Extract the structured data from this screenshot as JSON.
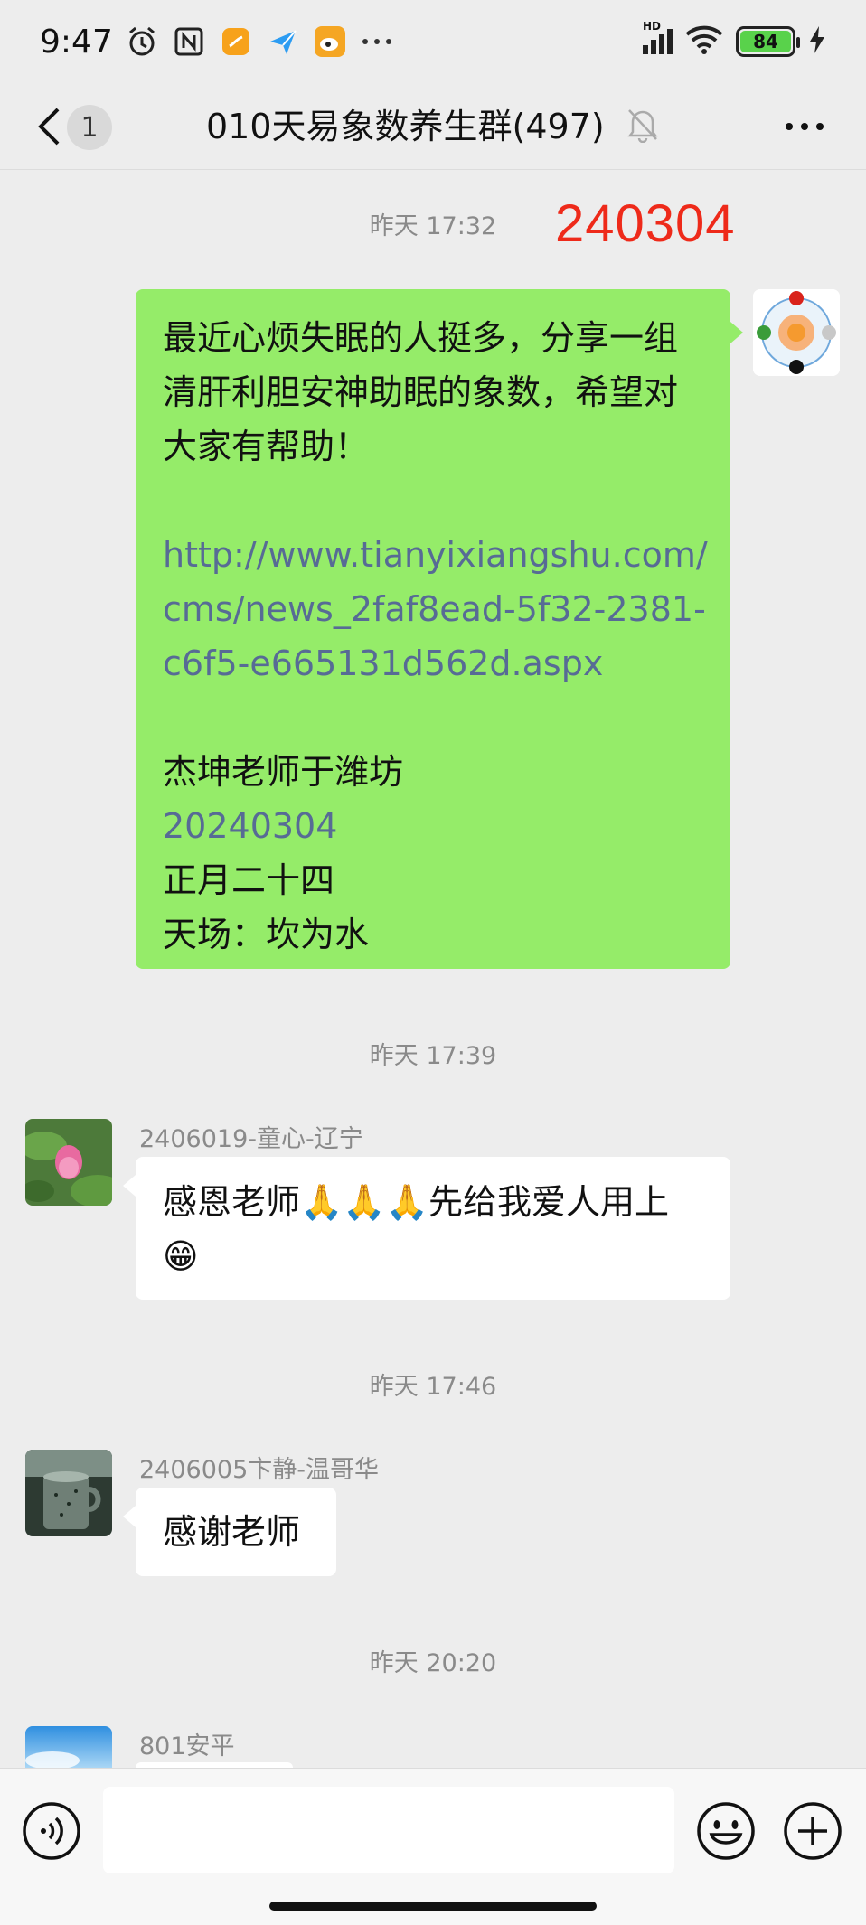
{
  "status_bar": {
    "time": "9:47",
    "network": "HD",
    "battery": "84"
  },
  "header": {
    "unread_count": "1",
    "title": "010天易象数养生群(497)"
  },
  "stamp": "240304",
  "messages": [
    {
      "time": "昨天 17:32",
      "type": "outgoing",
      "lines": [
        {
          "text": "最近心烦失眠的人挺多，分享一组",
          "link": false
        },
        {
          "text": "清肝利胆安神助眠的象数，希望对",
          "link": false
        },
        {
          "text": "大家有帮助！",
          "link": false
        },
        {
          "text": "",
          "link": false
        },
        {
          "text": "http://www.tianyixiangshu.com/",
          "link": true
        },
        {
          "text": "cms/news_2faf8ead-5f32-2381-",
          "link": true
        },
        {
          "text": "c6f5-e665131d562d.aspx",
          "link": true
        },
        {
          "text": "",
          "link": false
        },
        {
          "text": "杰坤老师于潍坊",
          "link": false
        },
        {
          "text": "20240304",
          "link": true
        },
        {
          "text": "正月二十四",
          "link": false
        },
        {
          "text": "天场：坎为水",
          "link": false
        }
      ]
    },
    {
      "time": "昨天 17:39",
      "type": "incoming",
      "sender": "2406019-童心-辽宁",
      "lines": [
        {
          "text": "感恩老师🙏🙏🙏先给我爱人用上",
          "link": false
        },
        {
          "text": "😁",
          "link": false
        }
      ]
    },
    {
      "time": "昨天 17:46",
      "type": "incoming",
      "sender": "2406005卞静-温哥华",
      "lines": [
        {
          "text": "感谢老师",
          "link": false
        }
      ]
    },
    {
      "time": "昨天 20:20",
      "type": "incoming",
      "sender": "801安平",
      "lines": []
    }
  ],
  "input": {
    "placeholder": ""
  },
  "colors": {
    "outgoing_bubble": "#95ec69",
    "incoming_bubble": "#ffffff",
    "link": "#576b95",
    "stamp": "#ee2a1a",
    "background": "#ededed"
  },
  "icons": [
    "back-icon",
    "mute-bell-icon",
    "more-icon",
    "voice-icon",
    "emoji-icon",
    "plus-icon"
  ]
}
